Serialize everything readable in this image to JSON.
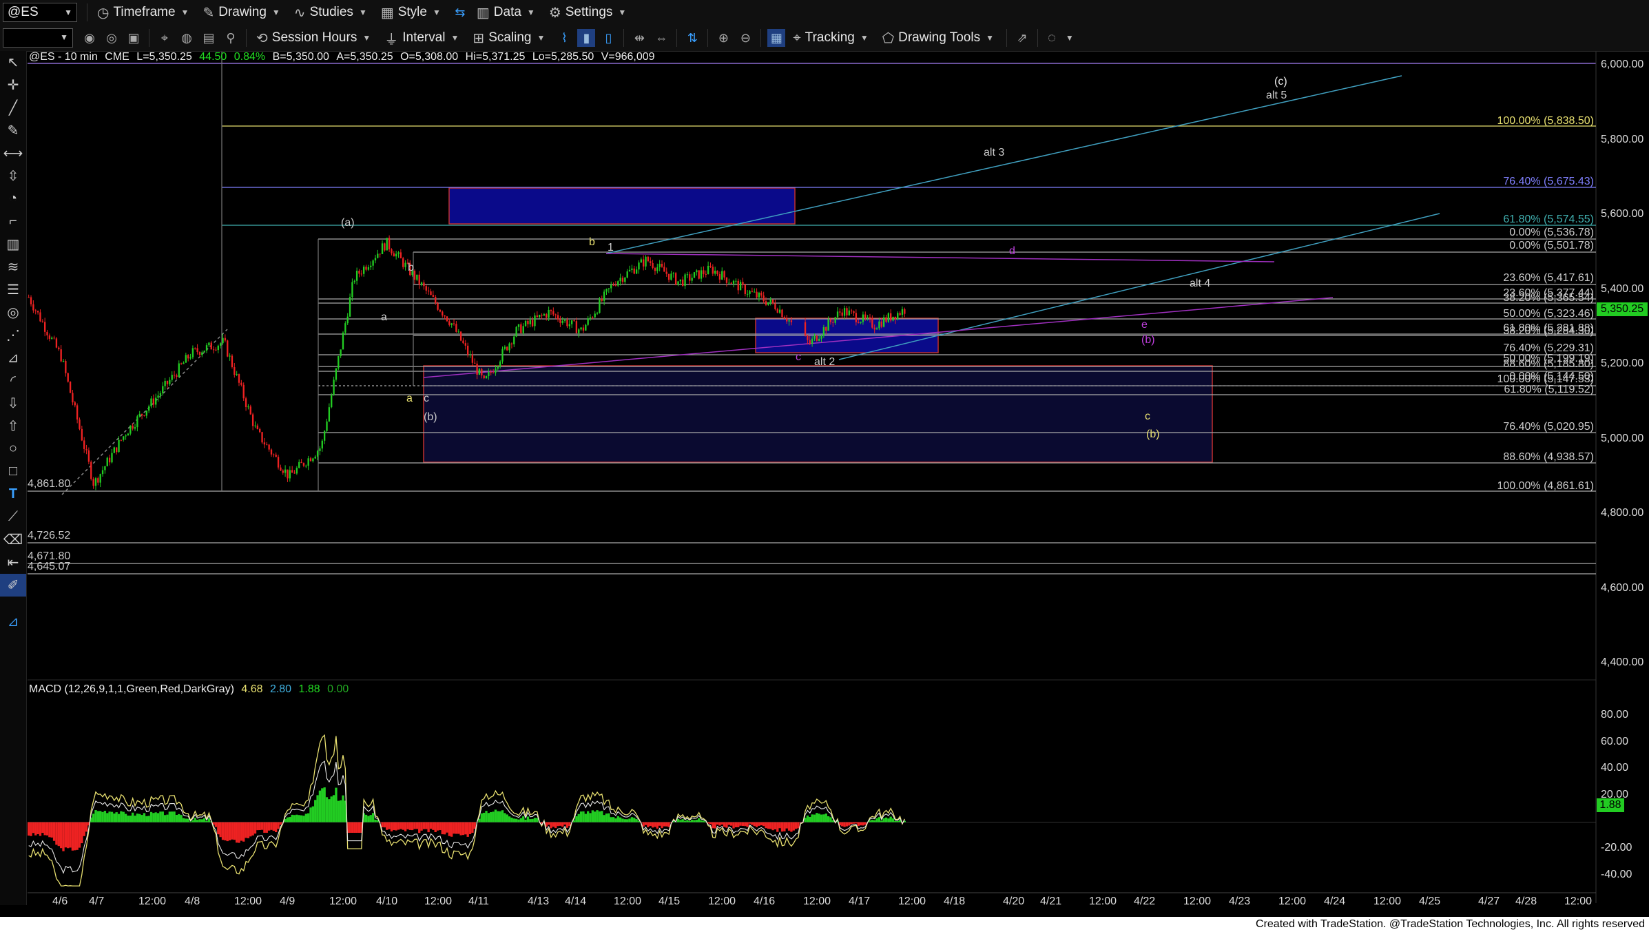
{
  "toolbar1": {
    "symbol": "@ES",
    "timeframe": "Timeframe",
    "drawing": "Drawing",
    "studies": "Studies",
    "style": "Style",
    "data": "Data",
    "settings": "Settings"
  },
  "toolbar2": {
    "session_hours": "Session Hours",
    "interval": "Interval",
    "scaling": "Scaling",
    "tracking": "Tracking",
    "drawing_tools": "Drawing Tools"
  },
  "header": {
    "symbol_interval": "@ES - 10 min",
    "exchange": "CME",
    "last": "L=5,350.25",
    "change": "44.50",
    "change_pct": "0.84%",
    "bid": "B=5,350.00",
    "ask": "A=5,350.25",
    "open": "O=5,308.00",
    "high": "Hi=5,371.25",
    "low": "Lo=5,285.50",
    "volume": "V=966,009"
  },
  "price_axis": [
    "6,000.00",
    "5,800.00",
    "5,600.00",
    "5,400.00",
    "5,200.00",
    "5,000.00",
    "4,800.00",
    "4,600.00",
    "4,400.00"
  ],
  "current_price": "5,350.25",
  "macd_axis": [
    "80.00",
    "60.00",
    "40.00",
    "20.00",
    "-20.00",
    "-40.00"
  ],
  "macd_current": "1.88",
  "macd_header": {
    "name": "MACD (12,26,9,1,1,Green,Red,DarkGray)",
    "v1": "4.68",
    "v2": "2.80",
    "v3": "1.88",
    "v4": "0.00"
  },
  "time_axis": [
    "4/6",
    "4/7",
    "12:00",
    "4/8",
    "12:00",
    "4/9",
    "12:00",
    "4/10",
    "12:00",
    "4/11",
    "4/13",
    "4/14",
    "12:00",
    "4/15",
    "12:00",
    "4/16",
    "12:00",
    "4/17",
    "12:00",
    "4/18",
    "4/20",
    "4/21",
    "12:00",
    "4/22",
    "12:00",
    "4/23",
    "12:00",
    "4/24",
    "12:00",
    "4/25",
    "4/27",
    "4/28",
    "12:00"
  ],
  "fib_labels": [
    {
      "text": "100.00% (5,838.50)",
      "color": "#e8e070"
    },
    {
      "text": "76.40% (5,675.43)",
      "color": "#8080ff"
    },
    {
      "text": "61.80% (5,574.55)",
      "color": "#40b0b0"
    },
    {
      "text": "0.00% (5,536.78)",
      "color": "#cccccc"
    },
    {
      "text": "0.00% (5,501.78)",
      "color": "#cccccc"
    },
    {
      "text": "23.60% (5,417.61)",
      "color": "#cccccc"
    },
    {
      "text": "23.60% (5,377.44)",
      "color": "#cccccc"
    },
    {
      "text": "38.20% (5,365.54)",
      "color": "#cccccc"
    },
    {
      "text": "50.00% (5,323.46)",
      "color": "#cccccc"
    },
    {
      "text": "61.80% (5,281.88)",
      "color": "#cccccc"
    },
    {
      "text": "38.20% (5,284.30)",
      "color": "#cccccc"
    },
    {
      "text": "76.40% (5,229.31)",
      "color": "#cccccc"
    },
    {
      "text": "50.00% (5,199.19)",
      "color": "#cccccc"
    },
    {
      "text": "88.60% (5,185.80)",
      "color": "#cccccc"
    },
    {
      "text": "100.00% (5,147.53)",
      "color": "#cccccc"
    },
    {
      "text": "0.00% (5,144.50)",
      "color": "#cccccc"
    },
    {
      "text": "61.80% (5,119.52)",
      "color": "#cccccc"
    },
    {
      "text": "76.40% (5,020.95)",
      "color": "#cccccc"
    },
    {
      "text": "88.60% (4,938.57)",
      "color": "#cccccc"
    },
    {
      "text": "100.00% (4,861.61)",
      "color": "#cccccc"
    }
  ],
  "level_labels": [
    "4,861.80",
    "4,726.52",
    "4,671.80",
    "4,645.07"
  ],
  "wave_labels": {
    "a_paren": "(a)",
    "b_paren_white": "(b)",
    "c_paren": "(c)",
    "alt5": "alt 5",
    "alt3": "alt 3",
    "alt4": "alt 4",
    "alt2": "alt 2",
    "a_white": "a",
    "b_white": "b",
    "c_white": "c",
    "one": "1",
    "b_yellow": "b",
    "a_yellow": "a",
    "c_yellow": "c",
    "b_paren_yellow": "(b)",
    "d_magenta": "d",
    "e_magenta": "e",
    "b_paren_magenta": "(b)",
    "c_magenta": "c"
  },
  "footer": "Created with TradeStation. @TradeStation Technologies, Inc. All rights reserved",
  "colors": {
    "background": "#000000",
    "up_candle": "#22cc22",
    "down_candle": "#ee2222",
    "zone_blue": "#0a0a8a",
    "zone_dark": "#0a0a30",
    "zone_border": "#c03030",
    "trend_cyan": "#40a0c0",
    "trend_magenta": "#a030c0",
    "macd_line": "#e8e070",
    "signal_line": "#e8e8e8"
  },
  "chart_data": {
    "type": "candlestick",
    "interval": "10 min",
    "ylim": [
      4350,
      6050
    ],
    "macd_ylim": [
      -50,
      90
    ],
    "price_path": [
      [
        "4/6 open",
        5380
      ],
      [
        "4/6",
        5220
      ],
      [
        "4/7 open",
        4880
      ],
      [
        "4/7",
        5020
      ],
      [
        "4/7 12:00",
        5120
      ],
      [
        "4/8 open",
        5230
      ],
      [
        "4/8",
        5260
      ],
      [
        "4/8 12:00",
        5020
      ],
      [
        "4/9 open",
        4900
      ],
      [
        "4/9",
        4980
      ],
      [
        "4/9 12:00",
        5430
      ],
      [
        "4/9 late",
        5525
      ],
      [
        "4/10 open",
        5420
      ],
      [
        "4/10",
        5310
      ],
      [
        "4/10 12:00",
        5150
      ],
      [
        "4/10 late",
        5290
      ],
      [
        "4/11",
        5340
      ],
      [
        "4/11 late",
        5290
      ],
      [
        "4/13",
        5420
      ],
      [
        "4/14",
        5480
      ],
      [
        "4/14 12:00",
        5420
      ],
      [
        "4/15",
        5455
      ],
      [
        "4/15 12:00",
        5400
      ],
      [
        "4/16",
        5355
      ],
      [
        "4/16 12:00",
        5255
      ],
      [
        "4/17",
        5345
      ],
      [
        "4/17 12:00",
        5305
      ],
      [
        "4/17 last",
        5350
      ]
    ]
  }
}
